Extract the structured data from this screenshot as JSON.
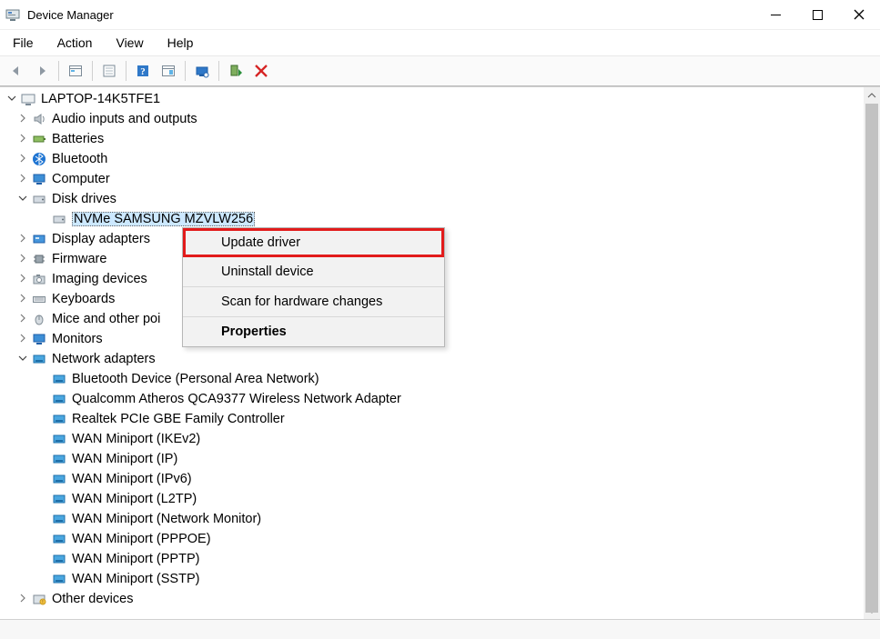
{
  "window": {
    "title": "Device Manager"
  },
  "menu": {
    "file": "File",
    "action": "Action",
    "view": "View",
    "help": "Help"
  },
  "tree": {
    "root": "LAPTOP-14K5TFE1",
    "audio": "Audio inputs and outputs",
    "batteries": "Batteries",
    "bluetooth": "Bluetooth",
    "computer": "Computer",
    "disk": "Disk drives",
    "nvme": "NVMe SAMSUNG MZVLW256",
    "display": "Display adapters",
    "firmware": "Firmware",
    "imaging": "Imaging devices",
    "keyboards": "Keyboards",
    "mice": "Mice and other poi",
    "monitors": "Monitors",
    "network": "Network adapters",
    "net_bt": "Bluetooth Device (Personal Area Network)",
    "net_qca": "Qualcomm Atheros QCA9377 Wireless Network Adapter",
    "net_realtek": "Realtek PCIe GBE Family Controller",
    "net_ikev2": "WAN Miniport (IKEv2)",
    "net_ip": "WAN Miniport (IP)",
    "net_ipv6": "WAN Miniport (IPv6)",
    "net_l2tp": "WAN Miniport (L2TP)",
    "net_netmon": "WAN Miniport (Network Monitor)",
    "net_pppoe": "WAN Miniport (PPPOE)",
    "net_pptp": "WAN Miniport (PPTP)",
    "net_sstp": "WAN Miniport (SSTP)",
    "other": "Other devices"
  },
  "context_menu": {
    "update": "Update driver",
    "uninstall": "Uninstall device",
    "scan": "Scan for hardware changes",
    "properties": "Properties"
  },
  "glyphs": {
    "expand": ">",
    "collapse": "v"
  }
}
